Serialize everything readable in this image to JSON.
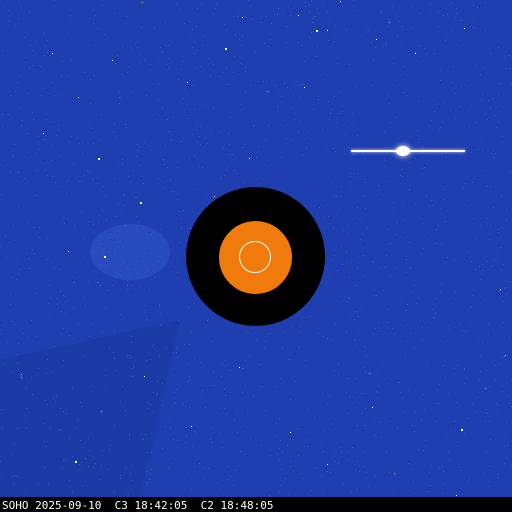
{
  "image": {
    "timestamp_text": "SOHO 2025-09-10  C3 18:42:05  C2 18:48:05",
    "colors": {
      "background": "#1f3fb0",
      "occulter_c3": "#000000",
      "occulter_c2": "#f07a0c",
      "sun_limb": "#ffffff"
    }
  }
}
